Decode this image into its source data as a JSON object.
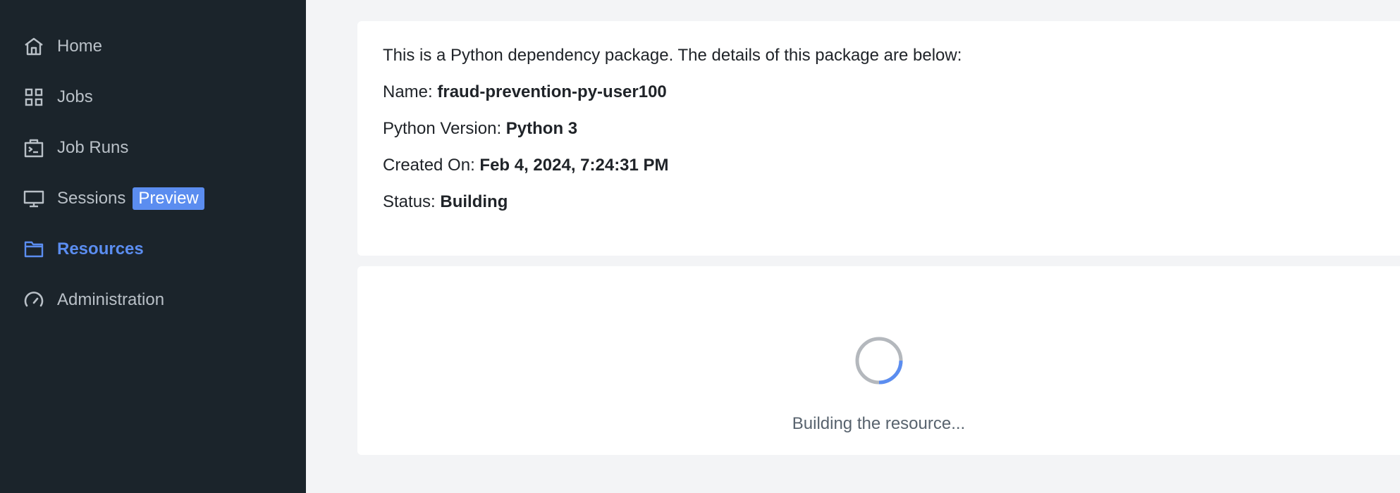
{
  "sidebar": {
    "items": [
      {
        "label": "Home",
        "icon": "home-icon"
      },
      {
        "label": "Jobs",
        "icon": "grid-icon"
      },
      {
        "label": "Job Runs",
        "icon": "terminal-icon"
      },
      {
        "label": "Sessions",
        "icon": "monitor-icon",
        "badge": "Preview"
      },
      {
        "label": "Resources",
        "icon": "folder-icon",
        "active": true
      },
      {
        "label": "Administration",
        "icon": "gauge-icon"
      }
    ]
  },
  "info": {
    "intro": "This is a Python dependency package. The details of this package are below:",
    "name_label": "Name: ",
    "name_value": "fraud-prevention-py-user100",
    "python_label": "Python Version: ",
    "python_value": "Python 3",
    "created_label": "Created On: ",
    "created_value": "Feb 4, 2024, 7:24:31 PM",
    "status_label": "Status: ",
    "status_value": "Building"
  },
  "build": {
    "message": "Building the resource..."
  },
  "colors": {
    "sidebar_bg": "#1b242b",
    "accent": "#5b8df0",
    "nav_text": "#b9c0c7"
  }
}
